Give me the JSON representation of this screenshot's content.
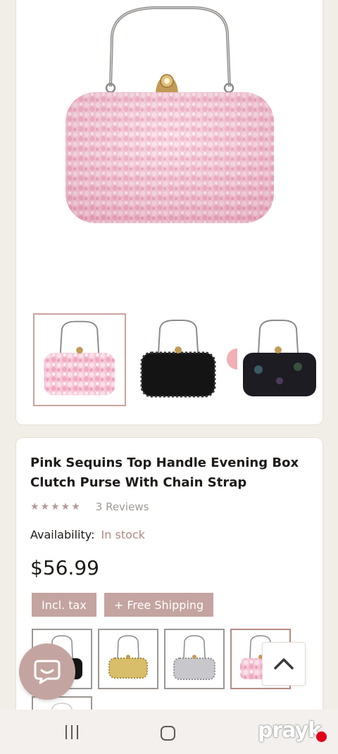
{
  "product": {
    "title_line1": "Pink Sequins Top Handle Evening Box",
    "title_line2": "Clutch Purse With Chain Strap",
    "stars": "★★★★★",
    "reviews": "3 Reviews",
    "availability_label": "Availability:",
    "availability_value": "In stock",
    "price": "$56.99",
    "badge_tax": "Incl. tax",
    "badge_shipping": "+ Free Shipping"
  },
  "gallery": {
    "thumbnails": [
      "pink",
      "black",
      "black-multi"
    ],
    "selected_index": 0,
    "watermark": "prayk"
  },
  "variants": {
    "colors": [
      "black",
      "gold",
      "silver",
      "pink"
    ],
    "selected_index": 3
  },
  "navbar": {
    "watermark": "prayk"
  },
  "colors": {
    "accent": "#c4a4a0",
    "in_stock": "#b0897f",
    "pink_bag": "#f4bcd0",
    "background": "#f1ede7"
  }
}
